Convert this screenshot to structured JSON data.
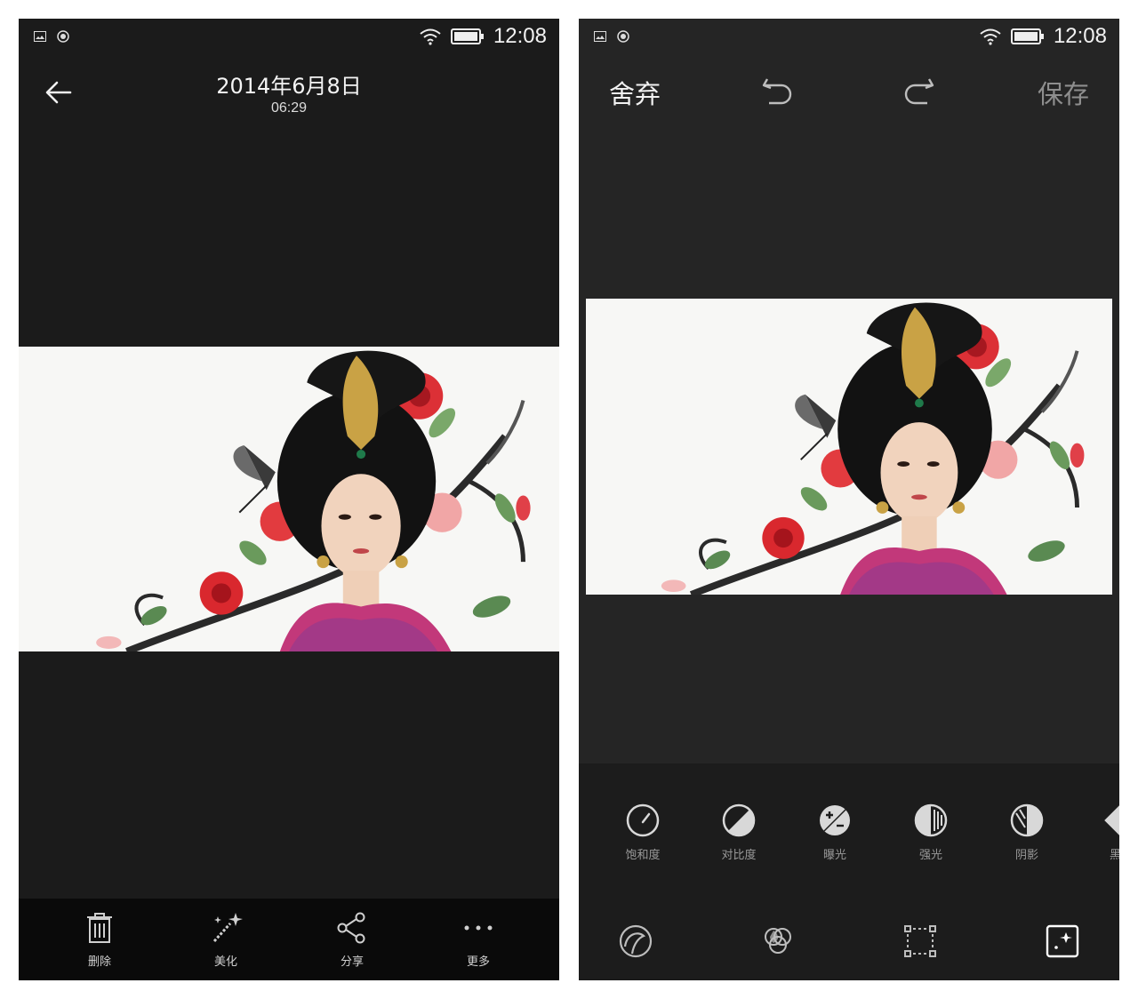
{
  "status_bar": {
    "time": "12:08"
  },
  "viewer": {
    "title": "2014年6月8日",
    "subtitle": "06:29",
    "actions": [
      {
        "label": "删除",
        "icon": "trash-icon"
      },
      {
        "label": "美化",
        "icon": "magic-wand-icon"
      },
      {
        "label": "分享",
        "icon": "share-icon"
      },
      {
        "label": "更多",
        "icon": "more-dots-icon"
      }
    ]
  },
  "editor": {
    "discard_label": "舍弃",
    "save_label": "保存",
    "adjustments": [
      {
        "label": "饱和度",
        "icon": "saturation-gauge-icon"
      },
      {
        "label": "对比度",
        "icon": "contrast-icon"
      },
      {
        "label": "曝光",
        "icon": "exposure-icon"
      },
      {
        "label": "强光",
        "icon": "highlight-icon"
      },
      {
        "label": "阴影",
        "icon": "shadow-icon"
      },
      {
        "label": "黑白",
        "icon": "black-white-icon"
      }
    ],
    "modes": [
      {
        "icon": "beauty-face-icon"
      },
      {
        "icon": "color-filter-icon"
      },
      {
        "icon": "crop-transform-icon"
      },
      {
        "icon": "adjust-enhance-icon",
        "selected": true
      }
    ]
  },
  "colors": {
    "viewer_bg": "#1b1b1b",
    "editor_bg": "#252525",
    "toolbar_bg": "#1c1c1c",
    "save_disabled": "#8e8e8e"
  }
}
